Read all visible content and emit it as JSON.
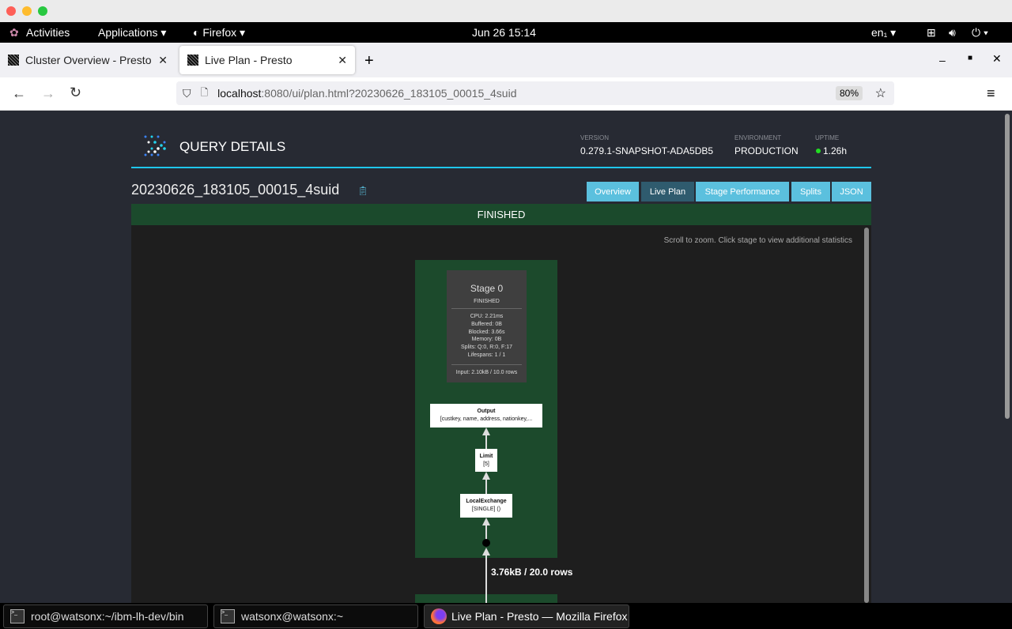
{
  "topbar": {
    "activities": "Activities",
    "applications": "Applications",
    "firefox": "Firefox",
    "datetime": "Jun 26  15:14",
    "lang": "en₁"
  },
  "browser": {
    "tabs": [
      {
        "label": "Cluster Overview - Presto",
        "active": false
      },
      {
        "label": "Live Plan - Presto",
        "active": true
      }
    ],
    "url_host": "localhost",
    "url_rest": ":8080/ui/plan.html?20230626_183105_00015_4suid",
    "zoom": "80%"
  },
  "header": {
    "title": "QUERY DETAILS",
    "version_label": "VERSION",
    "version": "0.279.1-SNAPSHOT-ADA5DB5",
    "environment_label": "ENVIRONMENT",
    "environment": "PRODUCTION",
    "uptime_label": "UPTIME",
    "uptime": "1.26h",
    "uptime_status_color": "#22dd22"
  },
  "query": {
    "id": "20230626_183105_00015_4suid",
    "state": "FINISHED"
  },
  "page_tabs": [
    {
      "label": "Overview",
      "active": false
    },
    {
      "label": "Live Plan",
      "active": true
    },
    {
      "label": "Stage Performance",
      "active": false
    },
    {
      "label": "Splits",
      "active": false
    },
    {
      "label": "JSON",
      "active": false
    }
  ],
  "plan": {
    "hint": "Scroll to zoom. Click stage to view additional statistics",
    "stage": {
      "title": "Stage 0",
      "state": "FINISHED",
      "stats": [
        "CPU: 2.21ms",
        "Buffered: 0B",
        "Blocked: 3.66s",
        "Memory: 0B",
        "Splits: Q:0, R:0, F:17",
        "Lifespans: 1 / 1"
      ],
      "input": "Input: 2.10kB / 10.0 rows"
    },
    "nodes": [
      {
        "name": "Output",
        "detail": "[custkey, name, address, nationkey,..."
      },
      {
        "name": "Limit",
        "detail": "[5]"
      },
      {
        "name": "LocalExchange",
        "detail": "[SINGLE] ()"
      }
    ],
    "edge_label": "3.76kB / 20.0 rows"
  },
  "taskbar": [
    {
      "label": "root@watsonx:~/ibm-lh-dev/bin",
      "icon": "terminal-icon"
    },
    {
      "label": "watsonx@watsonx:~",
      "icon": "terminal-icon"
    },
    {
      "label": "Live Plan - Presto — Mozilla Firefox",
      "icon": "firefox-icon"
    }
  ],
  "colors": {
    "accent": "#5bc0de",
    "finished": "#1b4a2c",
    "divider": "#1fc6ec"
  }
}
